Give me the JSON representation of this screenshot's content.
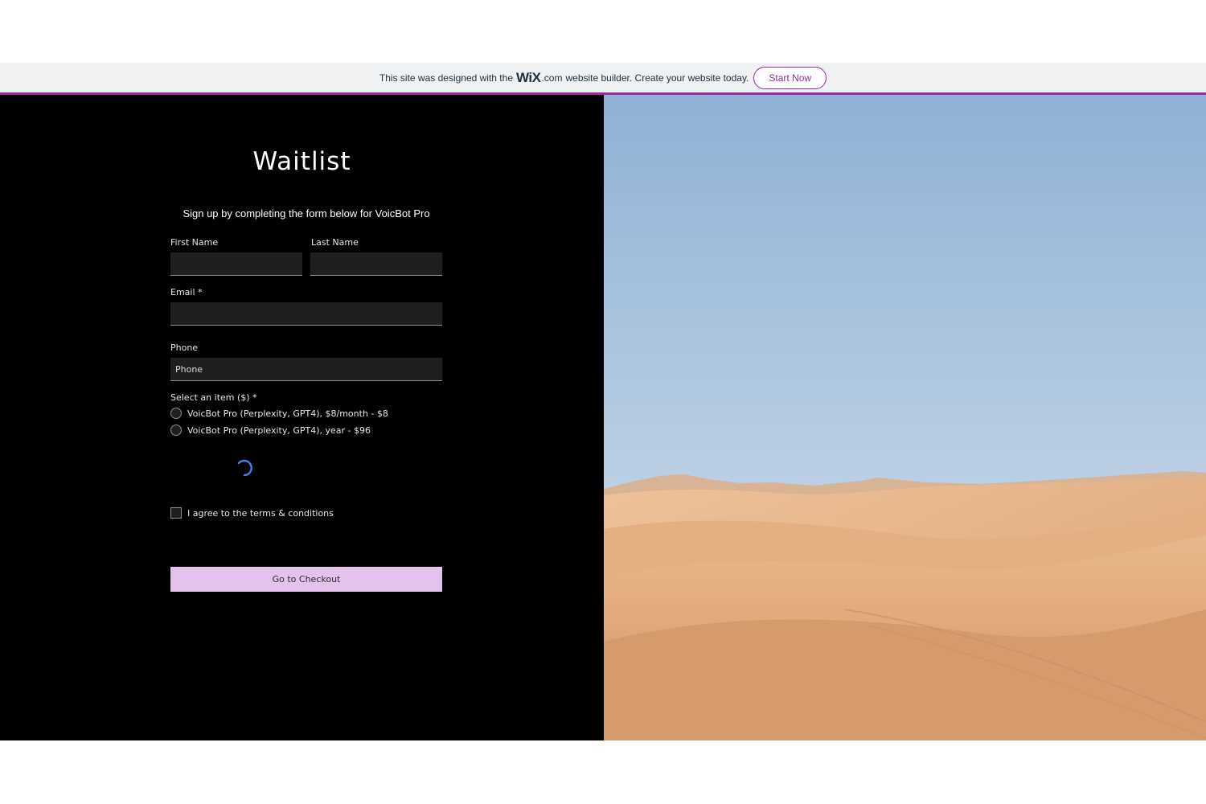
{
  "wix_banner": {
    "text_before": "This site was designed with the",
    "logo": "WiX",
    "logo_suffix": ".com",
    "text_after": "website builder. Create your website today.",
    "button_label": "Start Now"
  },
  "form": {
    "title": "Waitlist",
    "subtitle": "Sign up by completing the form below for VoicBot Pro",
    "first_name_label": "First Name",
    "first_name_value": "",
    "last_name_label": "Last Name",
    "last_name_value": "",
    "email_label": "Email *",
    "email_value": "",
    "phone_label": "Phone",
    "phone_placeholder": "Phone",
    "select_label": "Select an item ($) *",
    "options": [
      "VoicBot Pro (Perplexity, GPT4), $8/month - $8",
      "VoicBot Pro (Perplexity, GPT4), year - $96"
    ],
    "terms_label": "I agree to the terms & conditions",
    "checkout_label": "Go to Checkout"
  },
  "colors": {
    "accent_purple": "#9a27a6",
    "button_lavender": "#e3c2ec",
    "spinner_blue": "#3b82f6"
  },
  "icons": {
    "spinner": "loading-spinner-icon"
  }
}
